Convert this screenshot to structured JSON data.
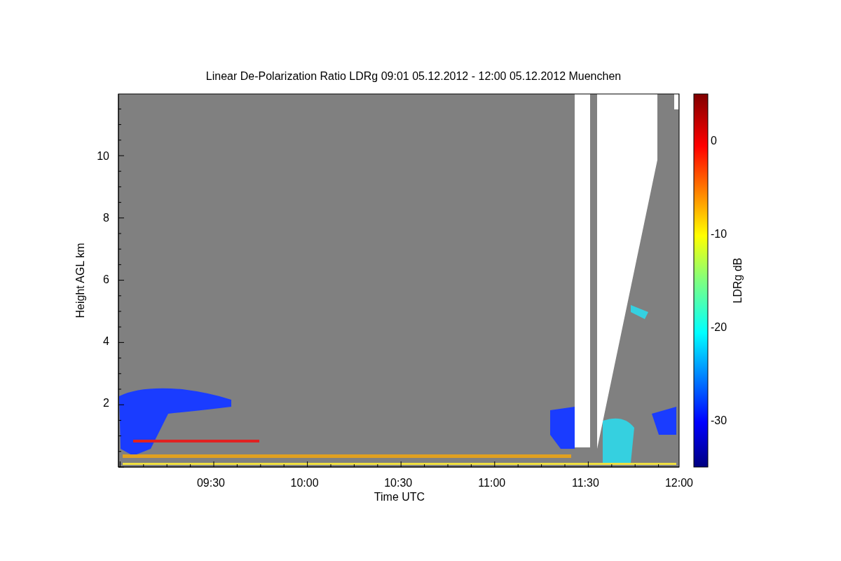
{
  "title": "Linear De-Polarization Ratio LDRg   09:01 05.12.2012 - 12:00 05.12.2012 Muenchen",
  "y_axis": {
    "label": "Height AGL km",
    "ticks": [
      "10",
      "8",
      "6",
      "4",
      "2"
    ]
  },
  "x_axis": {
    "label": "Time UTC",
    "ticks": [
      "09:30",
      "10:00",
      "10:30",
      "11:00",
      "11:30",
      "12:00"
    ]
  },
  "colorbar": {
    "label": "LDRg dB",
    "ticks": [
      "0",
      "-10",
      "-20",
      "-30"
    ]
  }
}
